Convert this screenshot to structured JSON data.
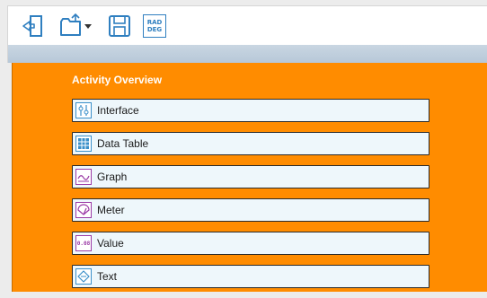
{
  "toolbar": {
    "buttons": [
      {
        "name": "exit-icon"
      },
      {
        "name": "open-folder-icon"
      },
      {
        "name": "save-icon"
      },
      {
        "name": "rad-deg-icon",
        "line1": "RAD",
        "line2": "DEG"
      }
    ]
  },
  "panel": {
    "title": "Activity Overview",
    "items": [
      {
        "label": "Interface",
        "icon": "interface-icon",
        "icon_color": "#3a8fc9"
      },
      {
        "label": "Data Table",
        "icon": "data-table-icon",
        "icon_color": "#3a8fc9"
      },
      {
        "label": "Graph",
        "icon": "graph-icon",
        "icon_color": "#9b3aa6"
      },
      {
        "label": "Meter",
        "icon": "meter-icon",
        "icon_color": "#9b3aa6"
      },
      {
        "label": "Value",
        "icon": "value-icon",
        "icon_color": "#9b3aa6",
        "glyph": "0.08"
      },
      {
        "label": "Text",
        "icon": "text-icon",
        "icon_color": "#3a8fc9"
      }
    ]
  },
  "colors": {
    "panel_bg": "#ff8c00",
    "toolbar_icon": "#2f7fc0"
  }
}
